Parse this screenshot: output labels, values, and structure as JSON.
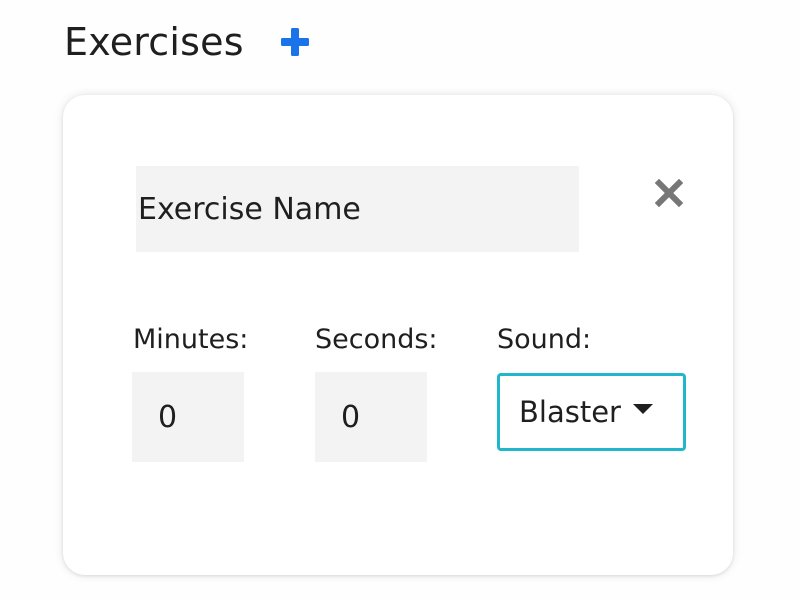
{
  "header": {
    "title": "Exercises",
    "add_icon": "plus-icon"
  },
  "exercise_card": {
    "name_placeholder": "Exercise Name",
    "close_icon": "close-icon",
    "minutes": {
      "label": "Minutes:",
      "value": "0"
    },
    "seconds": {
      "label": "Seconds:",
      "value": "0"
    },
    "sound": {
      "label": "Sound:",
      "selected": "Blaster"
    }
  },
  "colors": {
    "accent_blue": "#1a73e8",
    "select_border": "#21b7cb",
    "close_gray": "#777777",
    "input_bg": "#f3f3f3"
  }
}
